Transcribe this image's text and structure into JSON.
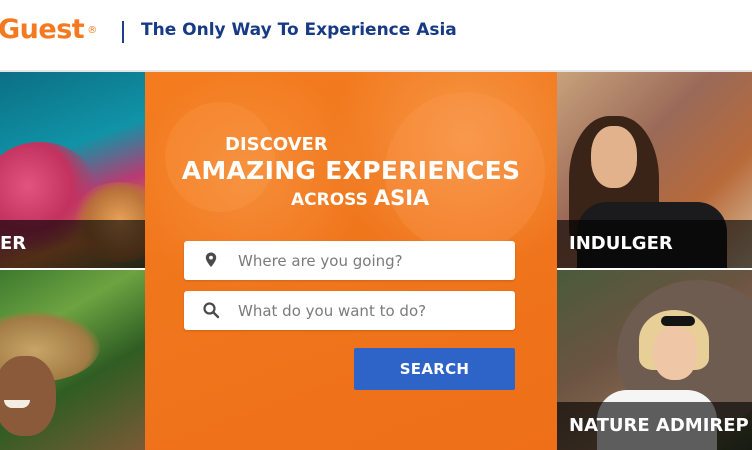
{
  "header": {
    "logo_text": "Guest",
    "logo_mark": "®",
    "tagline": "The Only Way To Experience Asia"
  },
  "hero": {
    "line1": "DISCOVER",
    "line2": "AMAZING EXPERIENCES",
    "line3_small": "ACROSS",
    "line3_big": "ASIA"
  },
  "search": {
    "where_placeholder": "Where are you going?",
    "where_icon": "map-pin-icon",
    "what_placeholder": "What do you want to do?",
    "what_icon": "search-icon",
    "button_label": "SEARCH"
  },
  "tiles": {
    "top_left_label": "ER",
    "top_right_label": "INDULGER",
    "bottom_right_label": "NATURE ADMIREP"
  },
  "colors": {
    "brand_orange": "#f47920",
    "brand_navy": "#173a84",
    "search_blue": "#2e64c8"
  }
}
